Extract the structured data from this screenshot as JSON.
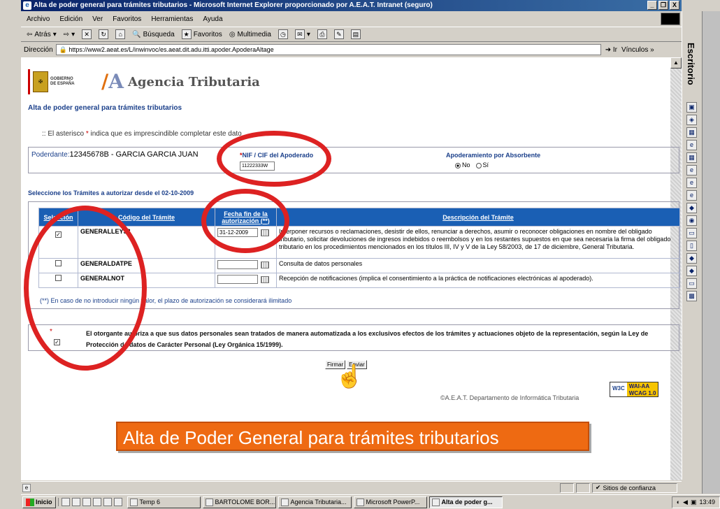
{
  "window": {
    "title": "Alta de poder general para trámites tributarios - Microsoft Internet Explorer proporcionado por A.E.A.T. Intranet (seguro)",
    "buttons": [
      "_",
      "❐",
      "X"
    ]
  },
  "menu": [
    "Archivo",
    "Edición",
    "Ver",
    "Favoritos",
    "Herramientas",
    "Ayuda"
  ],
  "toolbar": {
    "back": "Atrás",
    "search": "Búsqueda",
    "favorites": "Favoritos",
    "multimedia": "Multimedia"
  },
  "address": {
    "label": "Dirección",
    "url": "https://www2.aeat.es/L/inwinvoc/es.aeat.dit.adu.itti.apoder.ApoderaAltage",
    "go": "Ir",
    "links": "Vínculos"
  },
  "deskbar": {
    "label": "Escritorio"
  },
  "header": {
    "gov_line1": "GOBIERNO",
    "gov_line2": "DE ESPAÑA",
    "agency": "Agencia Tributaria"
  },
  "page": {
    "title": "Alta de poder general para trámites tributarios",
    "asterisk_note_pre": ":: El asterisco ",
    "asterisk_note_star": "*",
    "asterisk_note_post": " indica que es imprescindible completar este dato",
    "poderdante_label": "Poderdante:",
    "poderdante_value": "12345678B - GARCIA GARCIA JUAN",
    "nif_star": "*",
    "nif_label": "NIF / CIF del Apoderado",
    "nif_value": "11222333W",
    "absorbente_label": "Apoderamiento por Absorbente",
    "radio_no": "No",
    "radio_si": "Sí",
    "select_title": "Seleccione los Trámites a autorizar desde el 02-10-2009",
    "footnote": "(**) En caso de no introducir ningún valor, el plazo de autorización se considerará ilimitado",
    "consent_star": "*",
    "consent_text": "El otorgante autoriza a que sus datos personales sean tratados de manera automatizada a los exclusivos efectos de los trámites y actuaciones objeto de la representación, según la Ley de Protección de datos de Carácter Personal (Ley Orgánica 15/1999).",
    "btn_sign": "Firmar",
    "btn_send": "Enviar",
    "copyright": "©A.E.A.T. Departamento de Informática Tributaria",
    "w3c_a": "W3C",
    "w3c_b1": "WAI-AA",
    "w3c_b2": "WCAG 1.0"
  },
  "table": {
    "headers": [
      "Selección",
      "Código del Trámite",
      "Fecha fin de la autorización (**)",
      "Descripción del Trámite"
    ],
    "rows": [
      {
        "checked": "✓",
        "code": "GENERALLEY58",
        "date": "31-12-2009",
        "desc": "Interponer recursos o reclamaciones, desistir de ellos, renunciar a derechos, asumir o reconocer obligaciones en nombre del obligado tributario, solicitar devoluciones de ingresos indebidos o reembolsos y en los restantes supuestos en que sea necesaria la firma del obligado tributario en los procedimientos mencionados en los títulos III, IV y V de la Ley 58/2003, de 17 de diciembre, General Tributaria."
      },
      {
        "checked": "",
        "code": "GENERALDATPE",
        "date": "",
        "desc": "Consulta de datos personales"
      },
      {
        "checked": "",
        "code": "GENERALNOT",
        "date": "",
        "desc": "Recepción de notificaciones (implica el consentimiento a la práctica de notificaciones electrónicas al apoderado)."
      }
    ]
  },
  "caption": "Alta de Poder General para trámites tributarios",
  "statusbar": {
    "zone": "Sitios de confianza"
  },
  "taskbar": {
    "start": "Inicio",
    "tasks": [
      "Temp 6",
      "BARTOLOME BOR...",
      "Agencia Tributaria...",
      "Microsoft PowerP...",
      "Alta de poder g..."
    ],
    "clock": "13:49"
  },
  "colors": {
    "circle": "#d22222",
    "caption_bg": "#ee6a12",
    "table_header": "#1a5fb4",
    "titlebar": "#0a246a"
  }
}
